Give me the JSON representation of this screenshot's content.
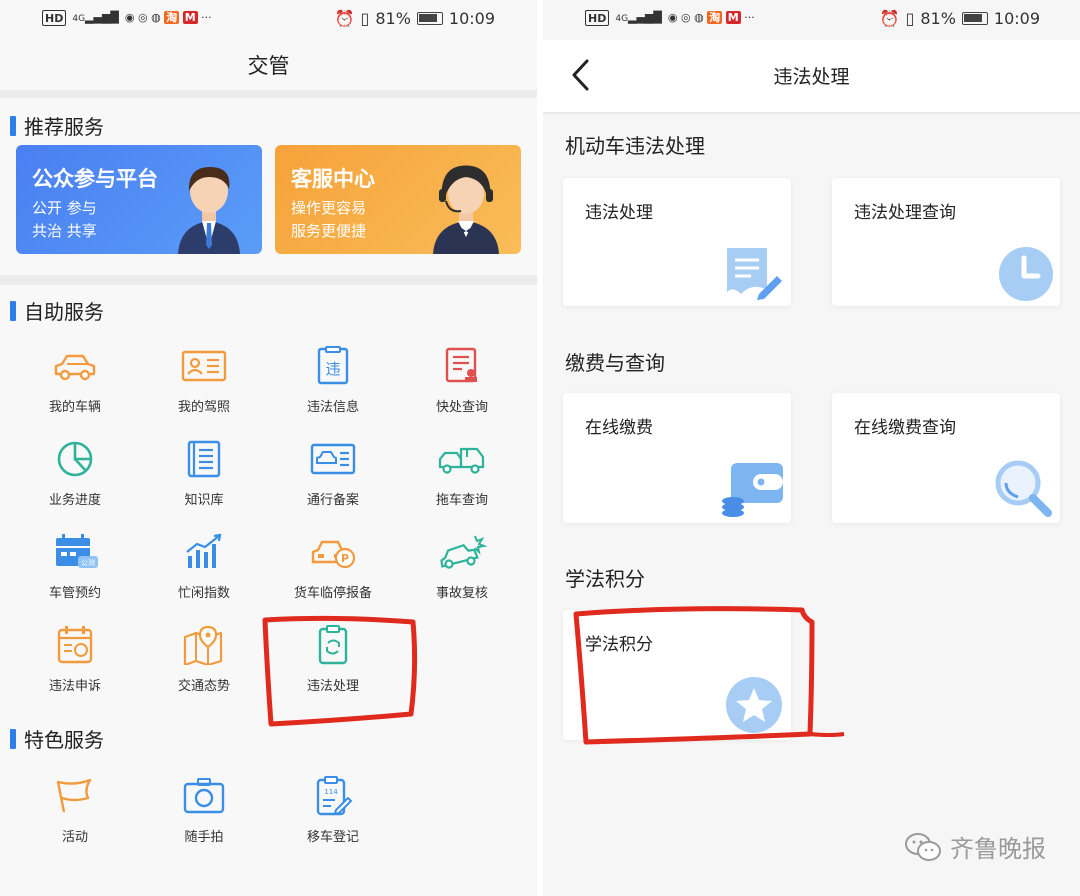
{
  "status": {
    "left_icons": [
      "HD",
      "4G"
    ],
    "battery": "81%",
    "time": "10:09"
  },
  "left": {
    "title": "交管",
    "sections": {
      "recommended": "推荐服务",
      "self": "自助服务",
      "featured": "特色服务"
    },
    "banners": [
      {
        "title": "公众参与平台",
        "line1": "公开 参与",
        "line2": "共治 共享",
        "color": "#4f7ff0"
      },
      {
        "title": "客服中心",
        "line1": "操作更容易",
        "line2": "服务更便捷",
        "color": "#f6a73a"
      }
    ],
    "self_services": [
      {
        "label": "我的车辆",
        "icon": "car-icon"
      },
      {
        "label": "我的驾照",
        "icon": "license-icon"
      },
      {
        "label": "违法信息",
        "icon": "violation-info-icon"
      },
      {
        "label": "快处查询",
        "icon": "quick-query-icon"
      },
      {
        "label": "业务进度",
        "icon": "pie-progress-icon"
      },
      {
        "label": "知识库",
        "icon": "knowledge-book-icon"
      },
      {
        "label": "通行备案",
        "icon": "pass-record-icon"
      },
      {
        "label": "拖车查询",
        "icon": "tow-truck-icon"
      },
      {
        "label": "车管预约",
        "icon": "calendar-appointment-icon"
      },
      {
        "label": "忙闲指数",
        "icon": "bar-chart-icon"
      },
      {
        "label": "货车临停报备",
        "icon": "truck-parking-icon"
      },
      {
        "label": "事故复核",
        "icon": "accident-car-icon"
      },
      {
        "label": "违法申诉",
        "icon": "appeal-calendar-icon"
      },
      {
        "label": "交通态势",
        "icon": "map-pin-icon"
      },
      {
        "label": "违法处理",
        "icon": "clipboard-refresh-icon"
      }
    ],
    "featured_services": [
      {
        "label": "活动",
        "icon": "flag-icon"
      },
      {
        "label": "随手拍",
        "icon": "camera-icon"
      },
      {
        "label": "移车登记",
        "icon": "clipboard-edit-icon"
      }
    ],
    "icon_blue": "#3a8ee6",
    "icon_orange": "#f19a3e"
  },
  "right": {
    "title": "违法处理",
    "sections": [
      "机动车违法处理",
      "缴费与查询",
      "学法积分"
    ],
    "cards": [
      {
        "label": "违法处理",
        "icon": "document-edit-icon"
      },
      {
        "label": "违法处理查询",
        "icon": "clock-icon"
      },
      {
        "label": "在线缴费",
        "icon": "wallet-icon"
      },
      {
        "label": "在线缴费查询",
        "icon": "magnifier-icon"
      },
      {
        "label": "学法积分",
        "icon": "star-icon"
      }
    ]
  },
  "watermark": "齐鲁晚报",
  "annotation_color": "#e12a1e"
}
